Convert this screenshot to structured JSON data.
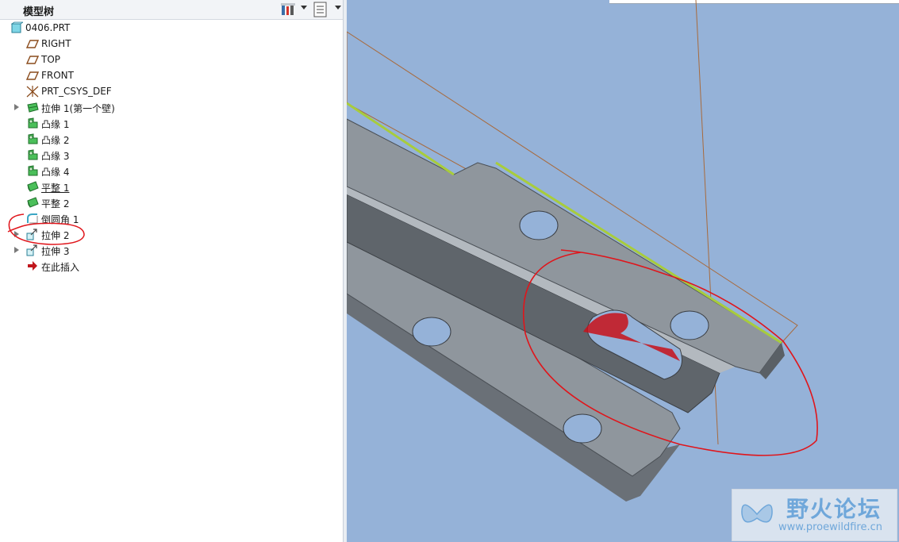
{
  "tree": {
    "title": "模型树",
    "items": [
      {
        "label": "0406.PRT",
        "icon": "part-icon"
      },
      {
        "label": "RIGHT",
        "icon": "datum-plane-icon"
      },
      {
        "label": "TOP",
        "icon": "datum-plane-icon"
      },
      {
        "label": "FRONT",
        "icon": "datum-plane-icon"
      },
      {
        "label": "PRT_CSYS_DEF",
        "icon": "coordinate-system-icon"
      },
      {
        "label": "拉伸 1(第一个壁)",
        "icon": "extrude-wall-icon"
      },
      {
        "label": "凸缘 1",
        "icon": "flange-icon"
      },
      {
        "label": "凸缘 2",
        "icon": "flange-icon"
      },
      {
        "label": "凸缘 3",
        "icon": "flange-icon"
      },
      {
        "label": "凸缘 4",
        "icon": "flange-icon"
      },
      {
        "label": "平整 1",
        "icon": "flat-wall-icon"
      },
      {
        "label": "平整 2",
        "icon": "flat-wall-icon"
      },
      {
        "label": "倒圆角 1",
        "icon": "round-icon"
      },
      {
        "label": "拉伸 2",
        "icon": "extrude-cut-icon"
      },
      {
        "label": "拉伸 3",
        "icon": "extrude-cut-icon"
      },
      {
        "label": "在此插入",
        "icon": "insert-here-arrow-icon"
      }
    ]
  },
  "watermark": {
    "title": "野火论坛",
    "url": "www.proewildfire.cn"
  },
  "colors": {
    "viewport_bg": "#95b2d8",
    "part_face": "#8f969d",
    "annotation_red": "#e0151b",
    "edge_highlight": "#a8cc3c",
    "insert_arrow": "#c0161c"
  }
}
